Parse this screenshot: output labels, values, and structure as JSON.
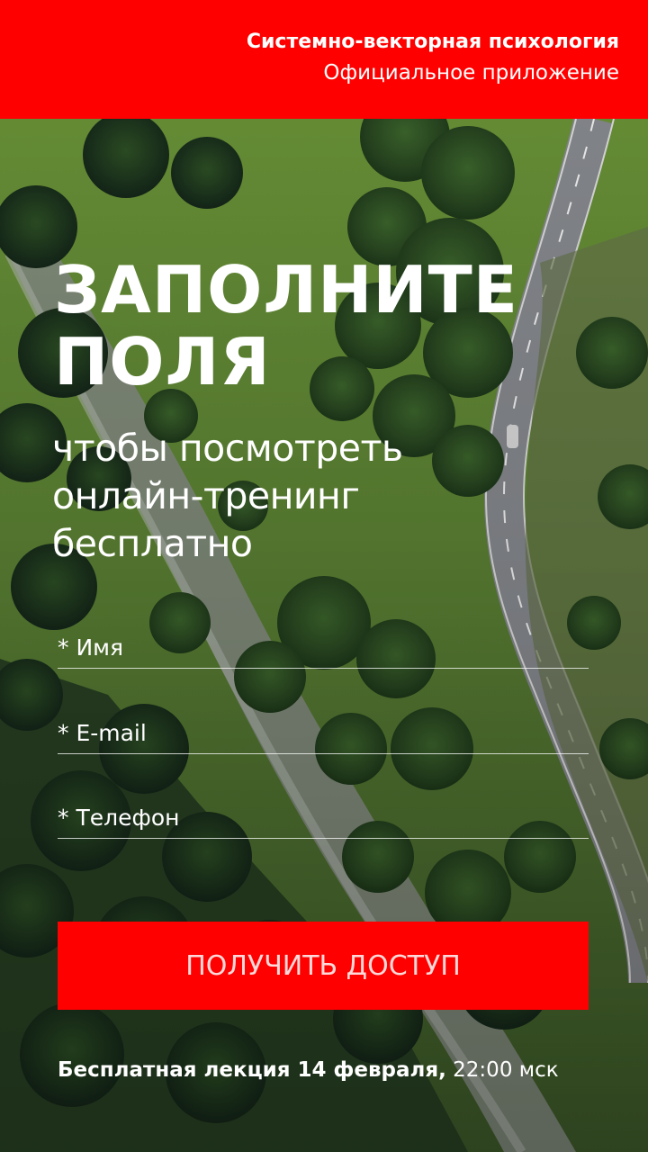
{
  "header": {
    "title": "Системно-векторная психология",
    "subtitle": "Официальное приложение"
  },
  "main": {
    "headline_line1": "ЗАПОЛНИТЕ",
    "headline_line2": "ПОЛЯ",
    "subhead_line1": "чтобы посмотреть",
    "subhead_line2": "онлайн-тренинг",
    "subhead_line3": "бесплатно"
  },
  "form": {
    "name_placeholder": "* Имя",
    "email_placeholder": "* E-mail",
    "phone_placeholder": "* Телефон",
    "submit_label": "ПОЛУЧИТЬ ДОСТУП"
  },
  "footer": {
    "lecture_text": "Бесплатная лекция 14 февраля,",
    "time_text": " 22:00 мск"
  },
  "colors": {
    "brand_red": "#fe0000",
    "text": "#ffffff"
  }
}
